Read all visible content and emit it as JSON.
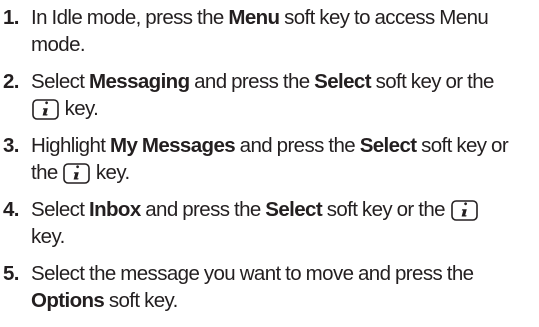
{
  "steps": [
    {
      "num": "1.",
      "t1": "In Idle mode, press the ",
      "b1": "Menu",
      "t2": " soft key to access Menu mode."
    },
    {
      "num": "2.",
      "t1": "Select ",
      "b1": "Messaging",
      "t2": " and press the ",
      "b2": "Select",
      "t3": " soft key or the",
      "t4": " key."
    },
    {
      "num": "3.",
      "t1": "Highlight ",
      "b1": "My Messages",
      "t2": " and press the ",
      "b2": "Select",
      "t3": " soft key or the ",
      "t4": " key."
    },
    {
      "num": "4.",
      "t1": "Select ",
      "b1": "Inbox",
      "t2": " and press the ",
      "b2": "Select",
      "t3": " soft key or the ",
      "t4": " key."
    },
    {
      "num": "5.",
      "t1": "Select the message you want to move and press the ",
      "b1": "Options",
      "t2": " soft key."
    }
  ],
  "icons": {
    "info_key": "info-i-key-icon"
  }
}
